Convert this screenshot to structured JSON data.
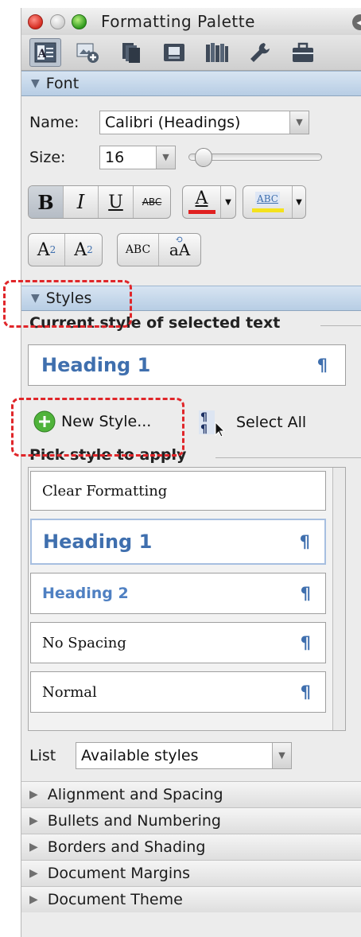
{
  "window": {
    "title": "Formatting Palette"
  },
  "toolbar": {
    "icons": [
      "formatting-palette-icon",
      "object-palette-icon",
      "citations-icon",
      "scrapbook-icon",
      "reference-tools-icon",
      "compatibility-report-icon",
      "projects-icon"
    ]
  },
  "font": {
    "header": "Font",
    "name_label": "Name:",
    "name_value": "Calibri (Headings)",
    "size_label": "Size:",
    "size_value": "16",
    "bold": "B",
    "italic": "I",
    "underline": "U",
    "strike": "ABC",
    "font_color_letter": "A",
    "highlight_text": "ABC",
    "superscript_base": "A",
    "superscript_exp": "2",
    "subscript_base": "A",
    "subscript_exp": "2",
    "small_caps": "ABC",
    "change_case": "aA",
    "colors": {
      "font_color": "#e02020",
      "highlight": "#f4e21c"
    }
  },
  "styles": {
    "header": "Styles",
    "current_label": "Current style of selected text",
    "current_style": "Heading 1",
    "pilcrow": "¶",
    "new_style": "New Style...",
    "select_all": "Select All",
    "pick_label": "Pick style to apply",
    "items": [
      {
        "name": "Clear Formatting",
        "pilcrow": ""
      },
      {
        "name": "Heading 1",
        "pilcrow": "¶"
      },
      {
        "name": "Heading 2",
        "pilcrow": "¶"
      },
      {
        "name": "No Spacing",
        "pilcrow": "¶"
      },
      {
        "name": "Normal",
        "pilcrow": "¶"
      }
    ],
    "list_label": "List",
    "list_value": "Available styles",
    "accent": "#3f6fae"
  },
  "sections": [
    "Alignment and Spacing",
    "Bullets and Numbering",
    "Borders and Shading",
    "Document Margins",
    "Document Theme"
  ]
}
